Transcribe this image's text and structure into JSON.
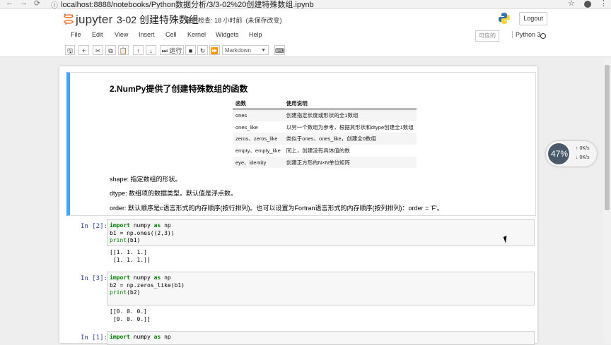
{
  "browser": {
    "url": "localhost:8888/notebooks/Python数据分析/3/3-02%20创建特殊数组.ipynb",
    "back_icon": "←",
    "forward_icon": "→",
    "reload_icon": "⟳",
    "info_icon": "ⓘ",
    "star_icon": "☆",
    "menu_icon": "⋮"
  },
  "header": {
    "logo_text": "jupyter",
    "notebook_name": "3-02 创建特殊数组",
    "checkpoint": "最后检查: 18 小时前",
    "unsaved": "(未保存改变)",
    "logout_label": "Logout"
  },
  "menubar": {
    "items": [
      "File",
      "Edit",
      "View",
      "Insert",
      "Cell",
      "Kernel",
      "Widgets",
      "Help"
    ],
    "trusted_label": "可信的",
    "kernel_label": "Python 3"
  },
  "toolbar": {
    "save_icon": "🖫",
    "add_icon": "+",
    "cut_icon": "✂",
    "copy_icon": "⧉",
    "paste_icon": "📋",
    "up_icon": "↑",
    "down_icon": "↓",
    "run_label": "⏭ 运行",
    "stop_icon": "■",
    "restart_icon": "↻",
    "fast_forward_icon": "⏩",
    "cell_type": "Markdown",
    "keyboard_icon": "⌨"
  },
  "markdown_cell": {
    "heading": "2.NumPy提供了创建特殊数组的函数",
    "table_headers": [
      "函数",
      "使用说明"
    ],
    "table_rows": [
      [
        "ones",
        "创建指定长度或形状的全1数组"
      ],
      [
        "ones_like",
        "以另一个数组为参考，根据其形状和dtype创建全1数组"
      ],
      [
        "zeros、zeros_like",
        "类似于ones、ones_like，创建全0数组"
      ],
      [
        "empty、empty_like",
        "同上，创建没有具体值的数"
      ],
      [
        "eye、identity",
        "创建正方形的N×N单位矩阵"
      ]
    ],
    "paragraphs": [
      "shape: 指定数组的形状。",
      "dtype: 数组项的数据类型。默认值是浮点数。",
      "order: 默认顺序是c语言形式的内存顺序(按行排列)。也可以设置为Fortran语言形式的内存顺序(按列排列)：order = 'F'。"
    ]
  },
  "cells": [
    {
      "prompt": "In  [2]:",
      "line1_kw1": "import",
      "line1_mid": " numpy ",
      "line1_kw2": "as",
      "line1_end": " np",
      "line2": "b1 = np.ones((2,3))",
      "line3_fn": "print",
      "line3_arg": "(b1)",
      "output": "[[1. 1. 1.]\n [1. 1. 1.]]"
    },
    {
      "prompt": "In  [3]:",
      "line1_kw1": "import",
      "line1_mid": " numpy ",
      "line1_kw2": "as",
      "line1_end": " np",
      "line2": "b2 = np.zeros_like(b1)",
      "line3_fn": "print",
      "line3_arg": "(b2)",
      "output": "[[0. 0. 0.]\n [0. 0. 0.]]"
    },
    {
      "prompt": "In  [1]:",
      "line1_kw1": "import",
      "line1_mid": " numpy ",
      "line1_kw2": "as",
      "line1_end": " np"
    }
  ],
  "net_widget": {
    "percent": "47%",
    "up_rate": "0K/s",
    "down_rate": "0K/s"
  },
  "colors": {
    "accent": "#42a5f5",
    "prompt": "#303f9f",
    "keyword": "#008000"
  }
}
